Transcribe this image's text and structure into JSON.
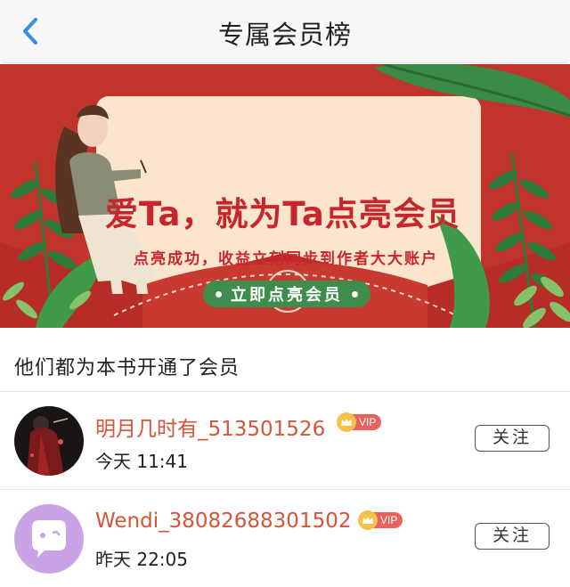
{
  "header": {
    "title": "专属会员榜",
    "back_icon": "chevron-left-icon",
    "accent_color": "#3a8ee6"
  },
  "banner": {
    "headline": "爱Ta，就为Ta点亮会员",
    "subtitle": "点亮成功，收益立刻同步到作者大大账户",
    "cta_label": "立即点亮会员",
    "background_color": "#c0342c",
    "card_color": "#fbe5cc",
    "cta_color": "#3f8d4c"
  },
  "section": {
    "title": "他们都为本书开通了会员"
  },
  "members": [
    {
      "name": "明月几时有_513501526",
      "badge": "VIP",
      "time": "今天 11:41",
      "follow_label": "关注",
      "avatar_icon": "dark-character-avatar"
    },
    {
      "name": "Wendi_38082688301502",
      "badge": "VIP",
      "time": "昨天 22:05",
      "follow_label": "关注",
      "avatar_icon": "chat-bubble-avatar"
    }
  ],
  "colors": {
    "member_name": "#d4553a",
    "vip_badge": "#e8615c",
    "crown": "#f3c24a"
  }
}
